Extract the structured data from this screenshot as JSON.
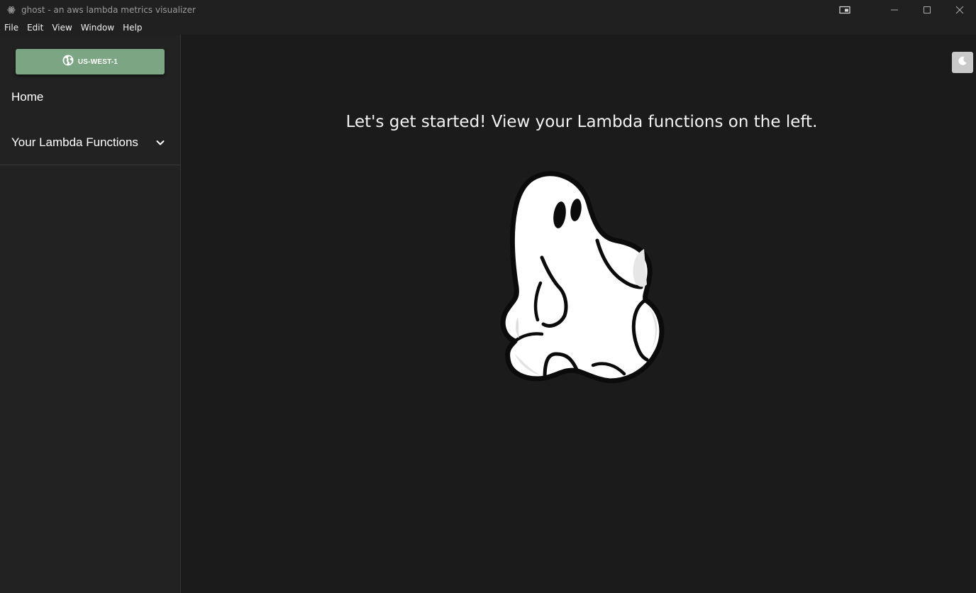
{
  "window": {
    "title": "ghost - an aws lambda metrics visualizer",
    "controls": [
      "cast-icon",
      "minimize-icon",
      "maximize-icon",
      "close-icon"
    ]
  },
  "menubar": {
    "items": [
      "File",
      "Edit",
      "View",
      "Window",
      "Help"
    ]
  },
  "sidebar": {
    "region_button": {
      "label": "US-WEST-1",
      "icon": "globe-icon",
      "color": "#7ca583"
    },
    "home_label": "Home",
    "functions_label": "Your Lambda Functions",
    "functions_icon": "chevron-down-icon"
  },
  "main": {
    "theme_toggle_icon": "moon-icon",
    "welcome_text": "Let's get started! View your Lambda functions on the left.",
    "illustration": "ghost-illustration"
  },
  "colors": {
    "background": "#1b1b1b",
    "sidebar": "#222222",
    "accent": "#7ca583"
  }
}
